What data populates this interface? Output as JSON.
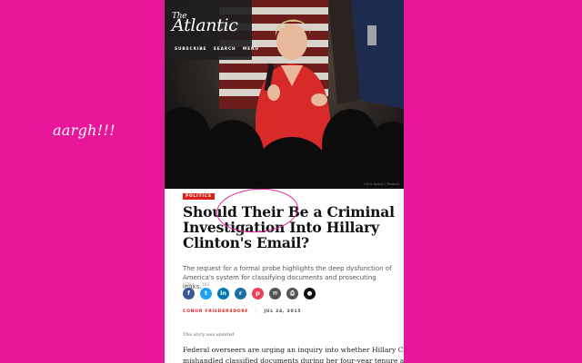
{
  "annotation": {
    "text": "aargh!!!"
  },
  "masthead": {
    "logo_prefix": "The",
    "logo_name": "Atlantic",
    "nav": [
      "SUBSCRIBE",
      "SEARCH",
      "MENU"
    ]
  },
  "hero": {
    "credit": "Chris Keane / Reuters"
  },
  "article": {
    "section_tag": "POLITICS",
    "headline": "Should Their Be a Criminal Investigation Into Hillary Clinton's Email?",
    "dek": "The request for a formal probe highlights the deep dysfunction of America's system for classifying documents and prosecuting leaks.",
    "share": {
      "counts": {
        "facebook": "23k",
        "twitter": "103"
      },
      "buttons": [
        {
          "name": "facebook",
          "icon": "f",
          "color": "#3b5998"
        },
        {
          "name": "twitter",
          "icon": "t",
          "color": "#1da1f2"
        },
        {
          "name": "linkedin",
          "icon": "in",
          "color": "#0077b5"
        },
        {
          "name": "reddit",
          "icon": "r",
          "color": "#1a6fa3"
        },
        {
          "name": "pocket",
          "icon": "p",
          "color": "#ee4056"
        },
        {
          "name": "email",
          "icon": "✉",
          "color": "#555555"
        },
        {
          "name": "print",
          "icon": "⎙",
          "color": "#555555"
        },
        {
          "name": "comments",
          "icon": "●",
          "color": "#111111"
        }
      ]
    },
    "author": "CONOR FRIEDERSDORF",
    "date": "JUL 24, 2015",
    "updated_note": "This story was updated",
    "body_lines": [
      "Federal overseers are urging an inquiry into whether Hillary Clinton illegally",
      "mishandled classified documents during her four-year tenure as secretary of"
    ]
  }
}
